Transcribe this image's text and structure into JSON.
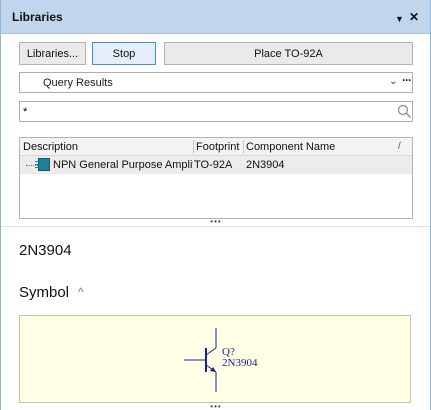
{
  "panel": {
    "title": "Libraries"
  },
  "titlebar": {
    "pin_glyph": "▼",
    "close_glyph": "✕"
  },
  "toolbar": {
    "libraries_label": "Libraries...",
    "stop_label": "Stop",
    "place_label": "Place TO-92A"
  },
  "query": {
    "selected": "Query Results",
    "chevron": "⌄",
    "more": "···"
  },
  "search": {
    "value": "*",
    "icon": "search-icon"
  },
  "table": {
    "columns": [
      "Description",
      "Footprint",
      "Component Name"
    ],
    "sort_glyph": "/",
    "rows": [
      {
        "description": "NPN General Purpose Amplifier",
        "footprint": "TO-92A",
        "component_name": "2N3904"
      }
    ]
  },
  "splitter_grip": "•••",
  "details": {
    "component_name": "2N3904",
    "symbol_section": "Symbol",
    "collapse_glyph": "^"
  },
  "symbol": {
    "designator": "Q?",
    "comment": "2N3904",
    "line_color": "#1c1c8c",
    "background": "#ffffe6"
  }
}
